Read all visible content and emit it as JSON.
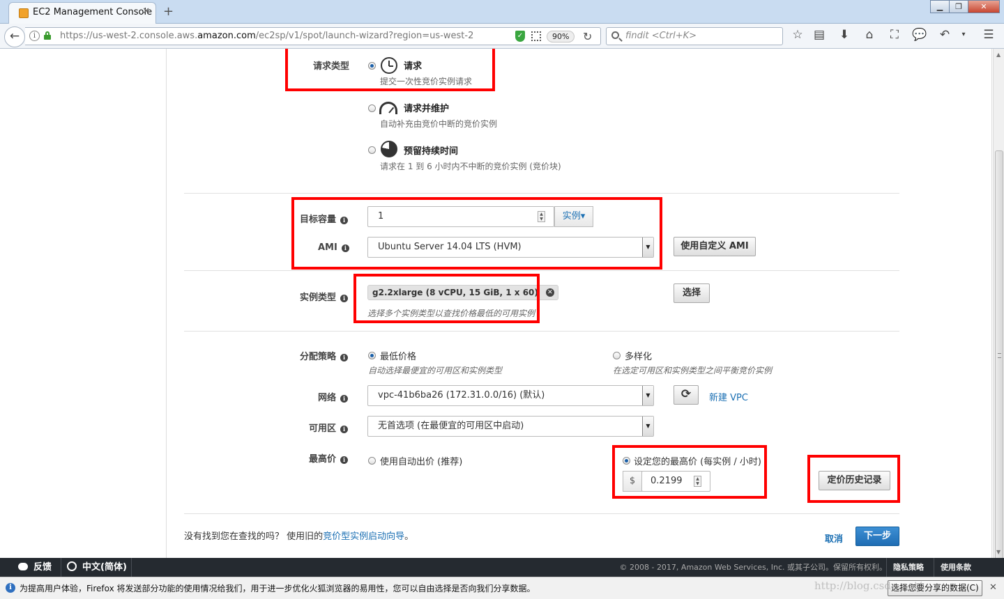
{
  "browser": {
    "tab_title": "EC2 Management Console",
    "url_prefix": "https://us-west-2.console.aws.",
    "url_domain": "amazon.com",
    "url_suffix": "/ec2sp/v1/spot/launch-wizard?region=us-west-2",
    "zoom": "90%",
    "search_placeholder": "findit <Ctrl+K>"
  },
  "request_type": {
    "label": "请求类型",
    "options": [
      {
        "title": "请求",
        "desc": "提交一次性竞价实例请求",
        "checked": true
      },
      {
        "title": "请求并维护",
        "desc": "自动补充由竞价中断的竞价实例",
        "checked": false
      },
      {
        "title": "预留持续时间",
        "desc": "请求在 1 到 6 小时内不中断的竞价实例 (竞价块)",
        "checked": false
      }
    ]
  },
  "capacity": {
    "label": "目标容量",
    "value": "1",
    "unit_button": "实例▾"
  },
  "ami": {
    "label": "AMI",
    "selected": "Ubuntu Server 14.04 LTS (HVM)",
    "custom_button": "使用自定义 AMI"
  },
  "instance_type": {
    "label": "实例类型",
    "chip": "g2.2xlarge (8 vCPU, 15 GiB, 1 x 60)",
    "hint": "选择多个实例类型以查找价格最低的可用实例",
    "select_button": "选择"
  },
  "allocation": {
    "label": "分配策略",
    "options": [
      {
        "title": "最低价格",
        "desc": "自动选择最便宜的可用区和实例类型",
        "checked": true
      },
      {
        "title": "多样化",
        "desc": "在选定可用区和实例类型之间平衡竞价实例",
        "checked": false
      }
    ]
  },
  "network": {
    "label": "网络",
    "selected": "vpc-41b6ba26 (172.31.0.0/16) (默认)",
    "new_vpc_link": "新建 VPC"
  },
  "availability_zone": {
    "label": "可用区",
    "selected": "无首选项 (在最便宜的可用区中启动)"
  },
  "max_price": {
    "label": "最高价",
    "auto_option": "使用自动出价 (推荐)",
    "manual_option": "设定您的最高价 (每实例 / 小时)",
    "currency": "$",
    "value": "0.2199",
    "history_button": "定价历史记录"
  },
  "bottom": {
    "text": "没有找到您在查找的吗？ 使用旧的",
    "link": "竞价型实例启动向导",
    "period": "。",
    "cancel": "取消",
    "next": "下一步"
  },
  "footer": {
    "feedback": "反馈",
    "language": "中文(简体)",
    "copyright": "© 2008 - 2017, Amazon Web Services, Inc. 或其子公司。保留所有权利。",
    "privacy": "隐私策略",
    "terms": "使用条款"
  },
  "notification": {
    "text": "为提高用户体验，Firefox 将发送部分功能的使用情况给我们，用于进一步优化火狐浏览器的易用性，您可以自由选择是否向我们分享数据。",
    "button": "选择您要分享的数据(C)"
  },
  "watermark": "http://blog.csdn.net/"
}
